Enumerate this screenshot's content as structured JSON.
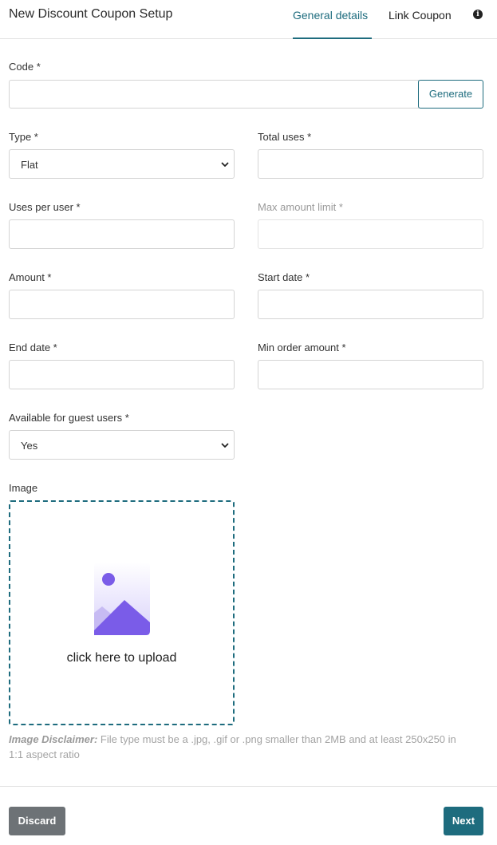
{
  "header": {
    "title": "New Discount Coupon Setup",
    "tabs": [
      {
        "label": "General details",
        "active": true
      },
      {
        "label": "Link Coupon",
        "active": false
      }
    ],
    "info_icon": "i",
    "accent_color": "#1e6c7e"
  },
  "form": {
    "code": {
      "label": "Code *",
      "value": "",
      "generate_label": "Generate"
    },
    "type": {
      "label": "Type *",
      "value": "Flat"
    },
    "total_uses": {
      "label": "Total uses *",
      "value": ""
    },
    "uses_per_user": {
      "label": "Uses per user *",
      "value": ""
    },
    "max_amount_limit": {
      "label": "Max amount limit *",
      "value": "",
      "disabled": true
    },
    "amount": {
      "label": "Amount *",
      "value": ""
    },
    "start_date": {
      "label": "Start date *",
      "value": ""
    },
    "end_date": {
      "label": "End date *",
      "value": ""
    },
    "min_order_amount": {
      "label": "Min order amount *",
      "value": ""
    },
    "guest_users": {
      "label": "Available for guest users *",
      "value": "Yes"
    },
    "image": {
      "label": "Image",
      "upload_text": "click here to upload",
      "icon": "image-placeholder-icon",
      "disclaimer_title": "Image Disclaimer:",
      "disclaimer_text": " File type must be a .jpg, .gif or .png smaller than 2MB and at least 250x250 in 1:1 aspect ratio"
    }
  },
  "footer": {
    "discard_label": "Discard",
    "next_label": "Next",
    "discard_color": "#6d7276",
    "next_color": "#1e6c7e"
  }
}
